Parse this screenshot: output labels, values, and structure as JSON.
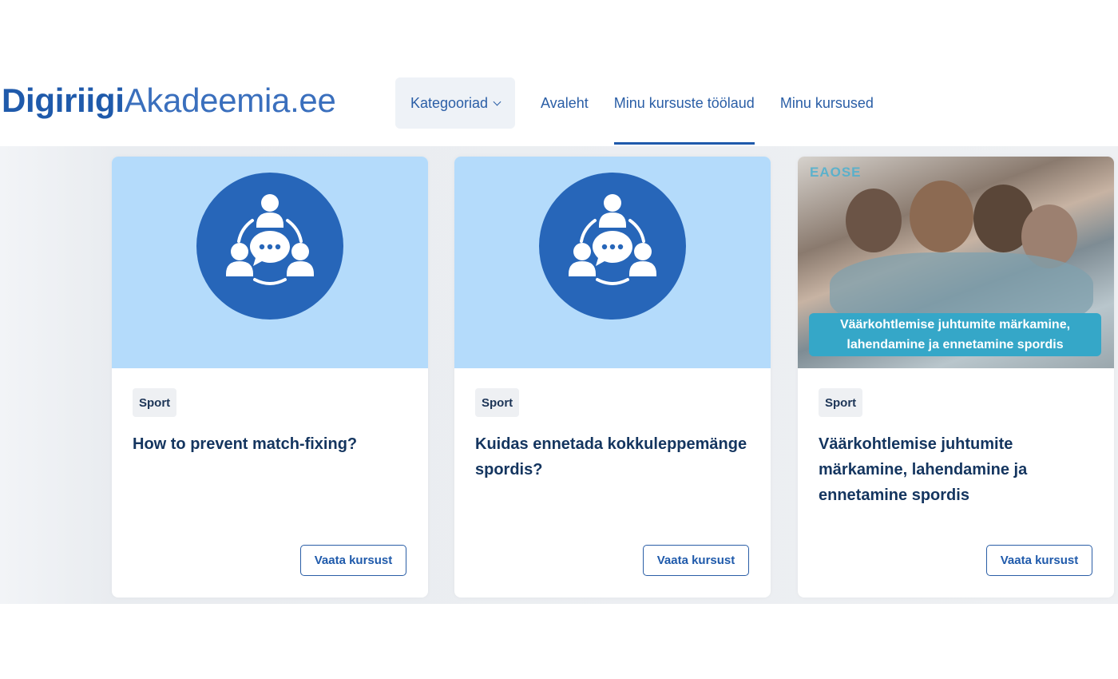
{
  "logo": {
    "bold": "Digiriigi",
    "light": "Akadeemia.ee"
  },
  "nav": {
    "categories": "Kategooriad",
    "links": [
      "Avaleht",
      "Minu kursuste töölaud",
      "Minu kursused"
    ],
    "active_link": "Minu kursuste töölaud"
  },
  "cards": [
    {
      "category": "Sport",
      "title": "How to prevent match-fixing?",
      "button": "Vaata kursust",
      "image": "group-discussion-icon"
    },
    {
      "category": "Sport",
      "title": "Kuidas ennetada kokkuleppemänge spordis?",
      "button": "Vaata kursust",
      "image": "group-discussion-icon"
    },
    {
      "category": "Sport",
      "title": "Väärkohtlemise juhtumite märkamine, lahendamine ja ennetamine spordis",
      "button": "Vaata kursust",
      "image": "team-huddle-photo",
      "banner_line1": "Väärkohtlemise juhtumite märkamine,",
      "banner_line2": "lahendamine ja ennetamine spordis",
      "photo_logo": "EAOSE"
    }
  ],
  "colors": {
    "brand": "#1f5aab",
    "card_image_bg": "#b4dbfb",
    "icon_circle": "#2766b9",
    "banner": "#35a7c8"
  }
}
